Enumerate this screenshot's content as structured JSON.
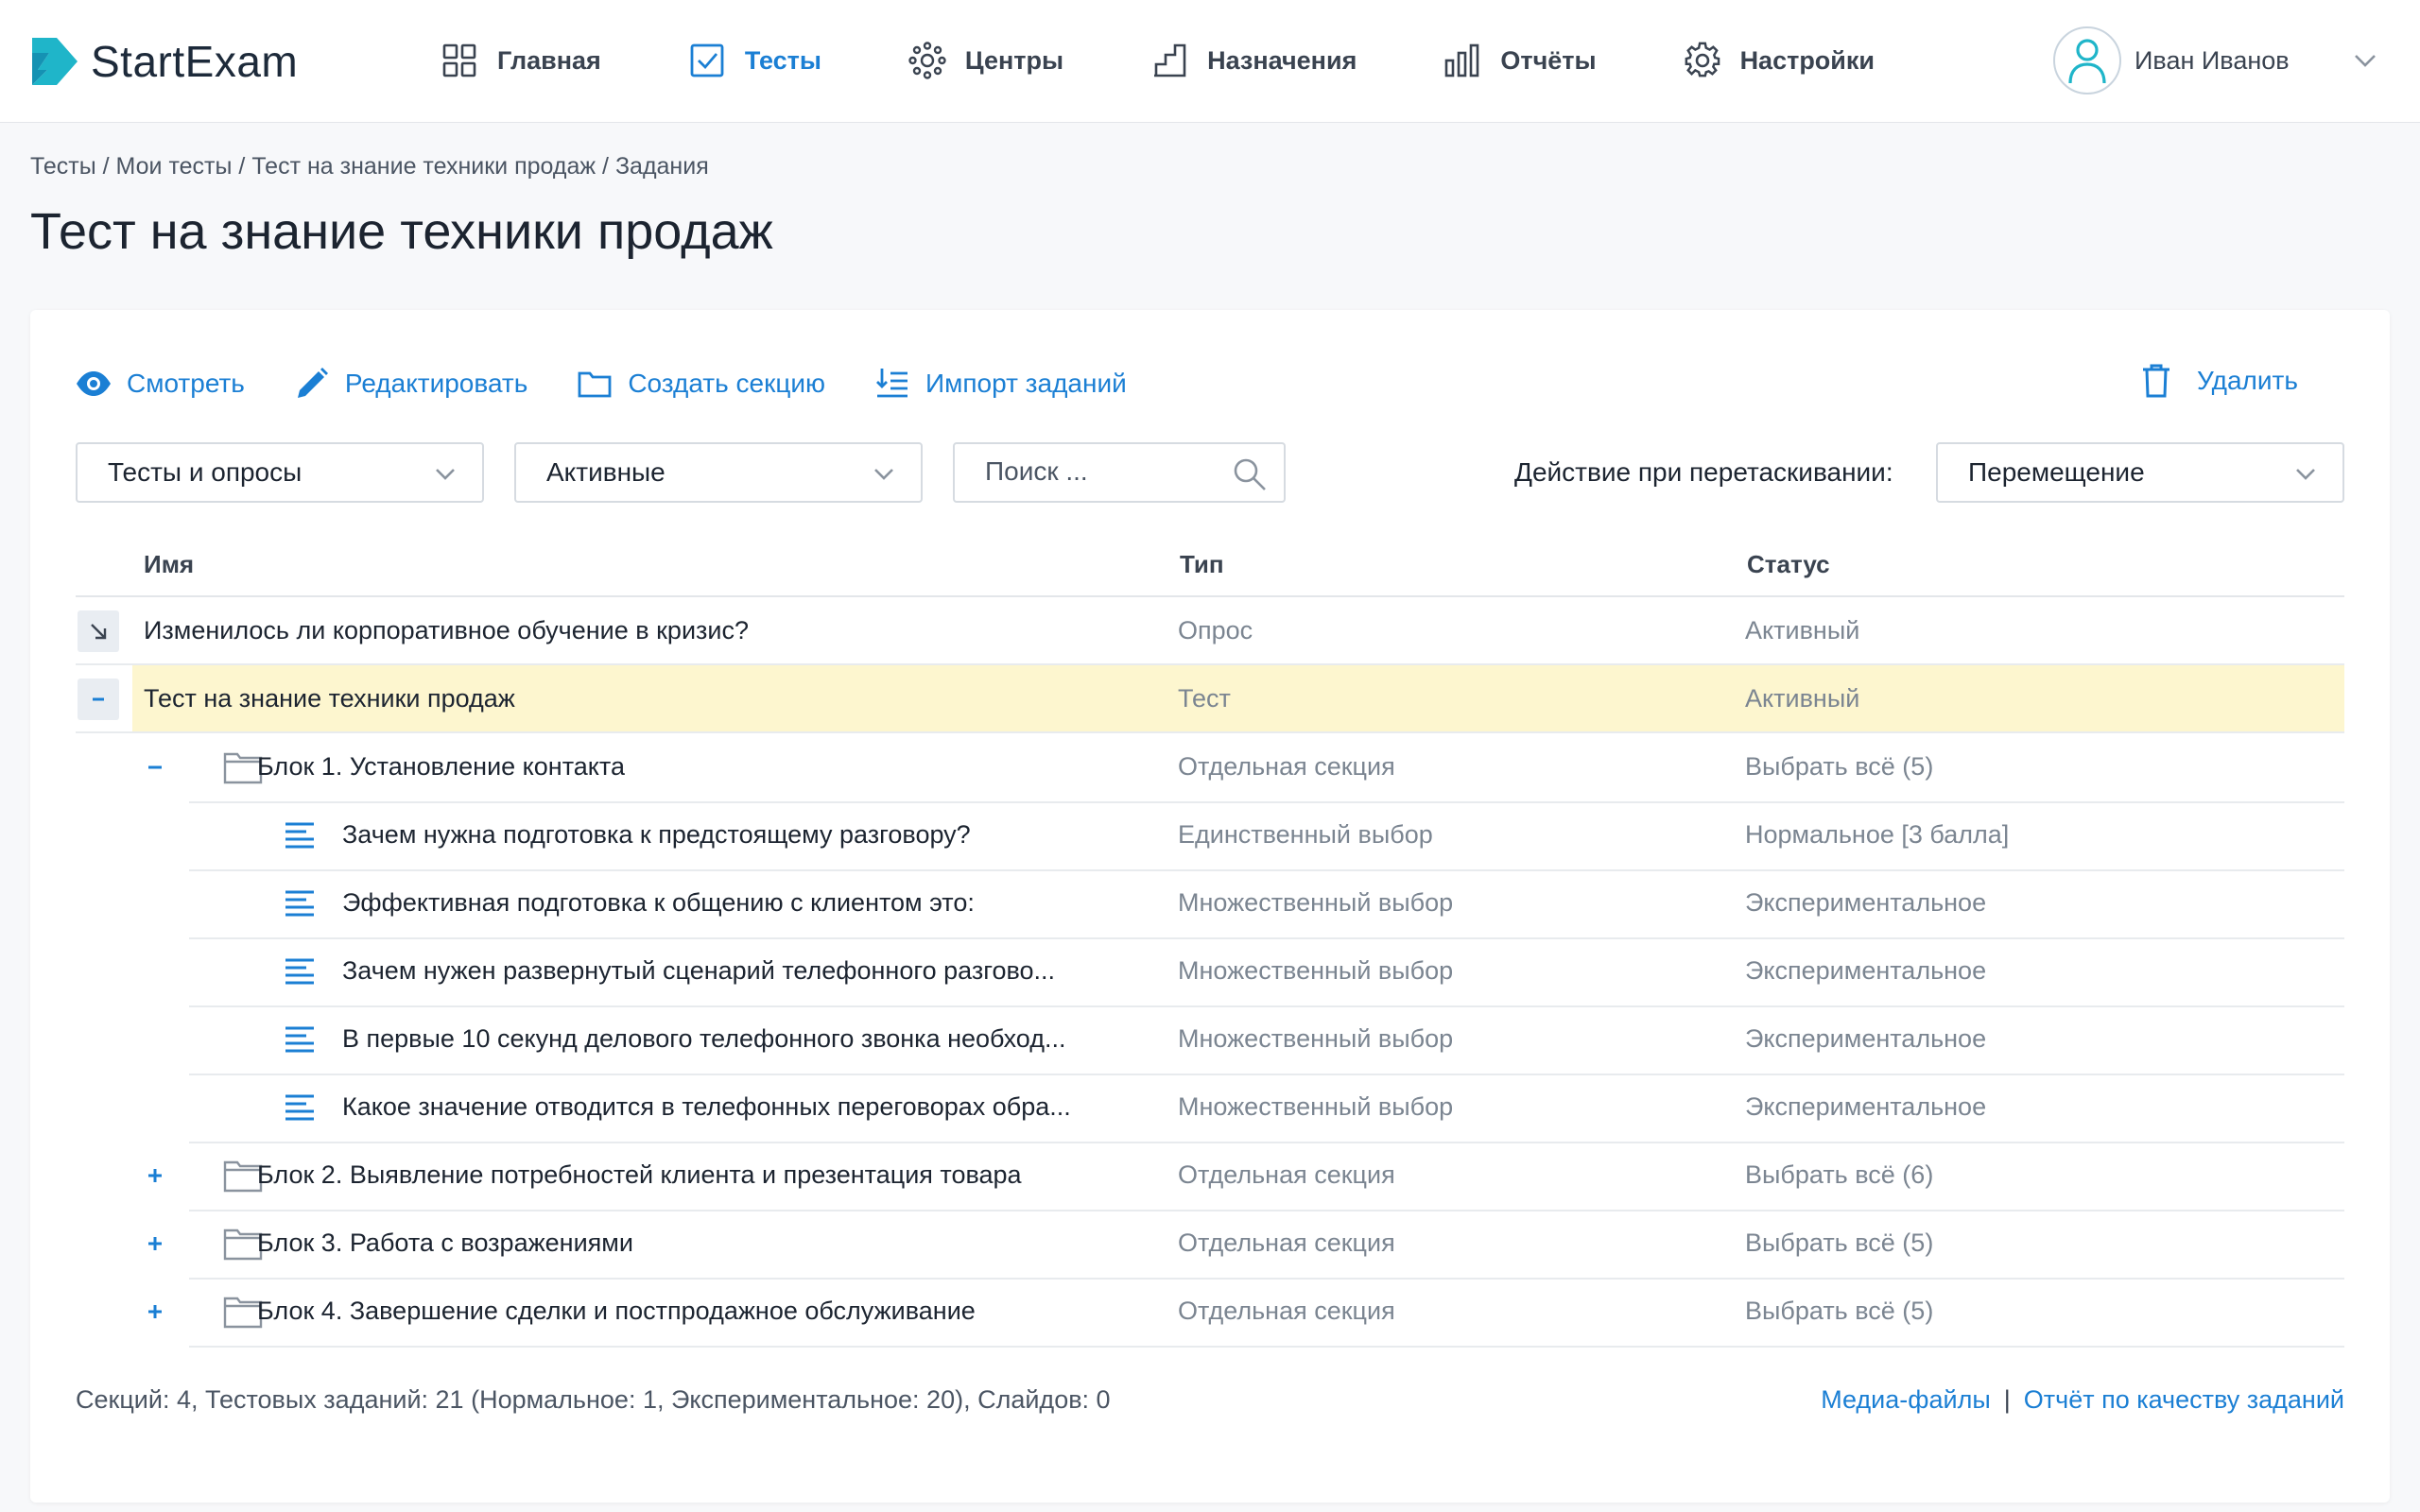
{
  "app": {
    "name": "StartExam"
  },
  "nav": [
    {
      "key": "home",
      "label": "Главная",
      "icon": "grid-icon"
    },
    {
      "key": "tests",
      "label": "Тесты",
      "icon": "checkbox-icon",
      "active": true
    },
    {
      "key": "centers",
      "label": "Центры",
      "icon": "network-icon"
    },
    {
      "key": "assignments",
      "label": "Назначения",
      "icon": "stairs-icon"
    },
    {
      "key": "reports",
      "label": "Отчёты",
      "icon": "bar-chart-icon"
    },
    {
      "key": "settings",
      "label": "Настройки",
      "icon": "gear-icon"
    }
  ],
  "user": {
    "name": "Иван Иванов"
  },
  "breadcrumb": [
    "Тесты",
    "Мои тесты",
    "Тест на знание техники продаж",
    "Задания"
  ],
  "page_title": "Тест на знание техники продаж",
  "toolbar": {
    "view": "Смотреть",
    "edit": "Редактировать",
    "create_section": "Создать секцию",
    "import": "Импорт заданий",
    "delete": "Удалить"
  },
  "filters": {
    "type": "Тесты и опросы",
    "status": "Активные",
    "search_placeholder": "Поиск ...",
    "drag_label": "Действие при перетаскивании:",
    "drag_action": "Перемещение"
  },
  "table": {
    "headers": {
      "name": "Имя",
      "type": "Тип",
      "status": "Статус"
    },
    "rows": [
      {
        "name": "Изменилось ли корпоративное обучение в кризис?",
        "type": "Опрос",
        "status": "Активный"
      },
      {
        "name": "Тест на знание техники продаж",
        "type": "Тест",
        "status": "Активный"
      },
      {
        "name": "Блок 1. Установление контакта",
        "type": "Отдельная секция",
        "status": "Выбрать всё (5)"
      },
      {
        "name": "Зачем нужна подготовка к предстоящему разговору?",
        "type": "Единственный выбор",
        "status": "Нормальное [3 балла]"
      },
      {
        "name": "Эффективная подготовка к общению с клиентом это:",
        "type": "Множественный выбор",
        "status": "Экспериментальное"
      },
      {
        "name": "Зачем нужен развернутый сценарий телефонного разгово...",
        "type": "Множественный выбор",
        "status": "Экспериментальное"
      },
      {
        "name": "В первые 10 секунд делового телефонного звонка необход...",
        "type": "Множественный выбор",
        "status": "Экспериментальное"
      },
      {
        "name": "Какое значение отводится в телефонных переговорах обра...",
        "type": "Множественный выбор",
        "status": "Экспериментальное"
      },
      {
        "name": "Блок 2. Выявление потребностей клиента и презентация товара",
        "type": "Отдельная секция",
        "status": "Выбрать всё (6)"
      },
      {
        "name": "Блок 3. Работа с возражениями",
        "type": "Отдельная секция",
        "status": "Выбрать всё (5)"
      },
      {
        "name": "Блок 4. Завершение сделки и постпродажное обслуживание",
        "type": "Отдельная секция",
        "status": "Выбрать всё (5)"
      }
    ]
  },
  "footer": {
    "stats": "Секций: 4, Тестовых заданий: 21 (Нормальное: 1, Экспериментальное: 20), Слайдов: 0",
    "media_link": "Медиа-файлы",
    "separator": "|",
    "quality_link": "Отчёт по качеству заданий"
  },
  "colors": {
    "accent": "#1b7fd4",
    "highlight": "#fdf6cf",
    "logo": "#1fb5c9"
  }
}
